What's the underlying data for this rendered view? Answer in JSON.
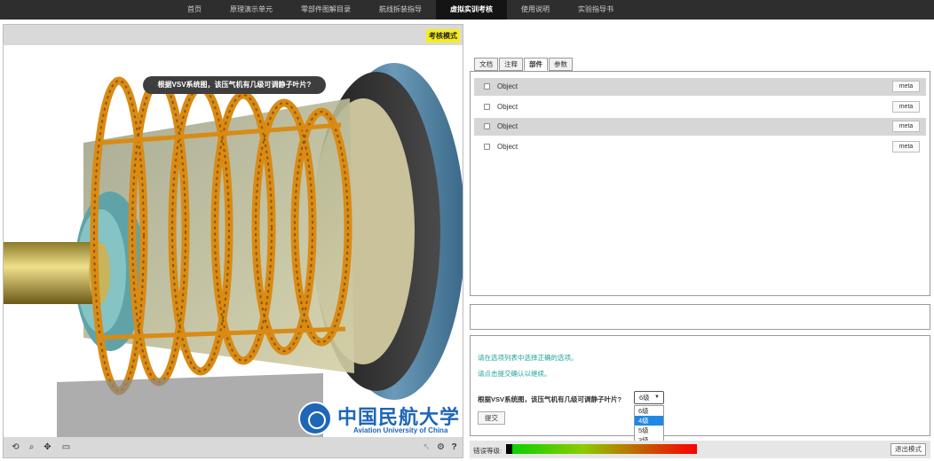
{
  "nav": {
    "items": [
      "首页",
      "原理演示单元",
      "零部件图解目录",
      "航线拆装指导",
      "虚拟实训考核",
      "使用说明",
      "实验指导书"
    ],
    "active_index": 4
  },
  "viewer": {
    "mode_badge": "考核模式",
    "question": "根据VSV系统图，该压气机有几级可调静子叶片?",
    "logo": {
      "cn": "中国民航大学",
      "en": "Aviation University of China"
    },
    "toolbar_icons": [
      "rotate-icon",
      "zoom-icon",
      "pan-icon",
      "fit-view-icon",
      "select-cursor-icon",
      "settings-icon",
      "help-icon"
    ]
  },
  "panel": {
    "tabs": [
      "文档",
      "注释",
      "部件",
      "参数"
    ],
    "active_tab": 2,
    "parts": [
      {
        "name": "Object",
        "button": "meta",
        "shaded": true
      },
      {
        "name": "Object",
        "button": "meta",
        "shaded": false
      },
      {
        "name": "Object",
        "button": "meta",
        "shaded": true
      },
      {
        "name": "Object",
        "button": "meta",
        "shaded": false
      }
    ]
  },
  "quiz": {
    "hint1": "请在选项列表中选择正确的选项。",
    "hint2": "请点击提交确认以继续。",
    "question": "根据VSV系统图，该压气机有几级可调静子叶片?",
    "selected": "6级",
    "options": [
      "6级",
      "4级",
      "5级",
      "3级"
    ],
    "highlighted_option": 1,
    "submit": "提交"
  },
  "bottom": {
    "error_label": "错误等级:",
    "error_level": 0.03,
    "exit": "退出模式"
  },
  "colors": {
    "accent_teal": "#1fa39a",
    "badge_yellow": "#f6ee1c",
    "nav_bg": "#2e2e2e",
    "orange_frame": "#d98b14",
    "casing_blue": "#4a7a98"
  }
}
